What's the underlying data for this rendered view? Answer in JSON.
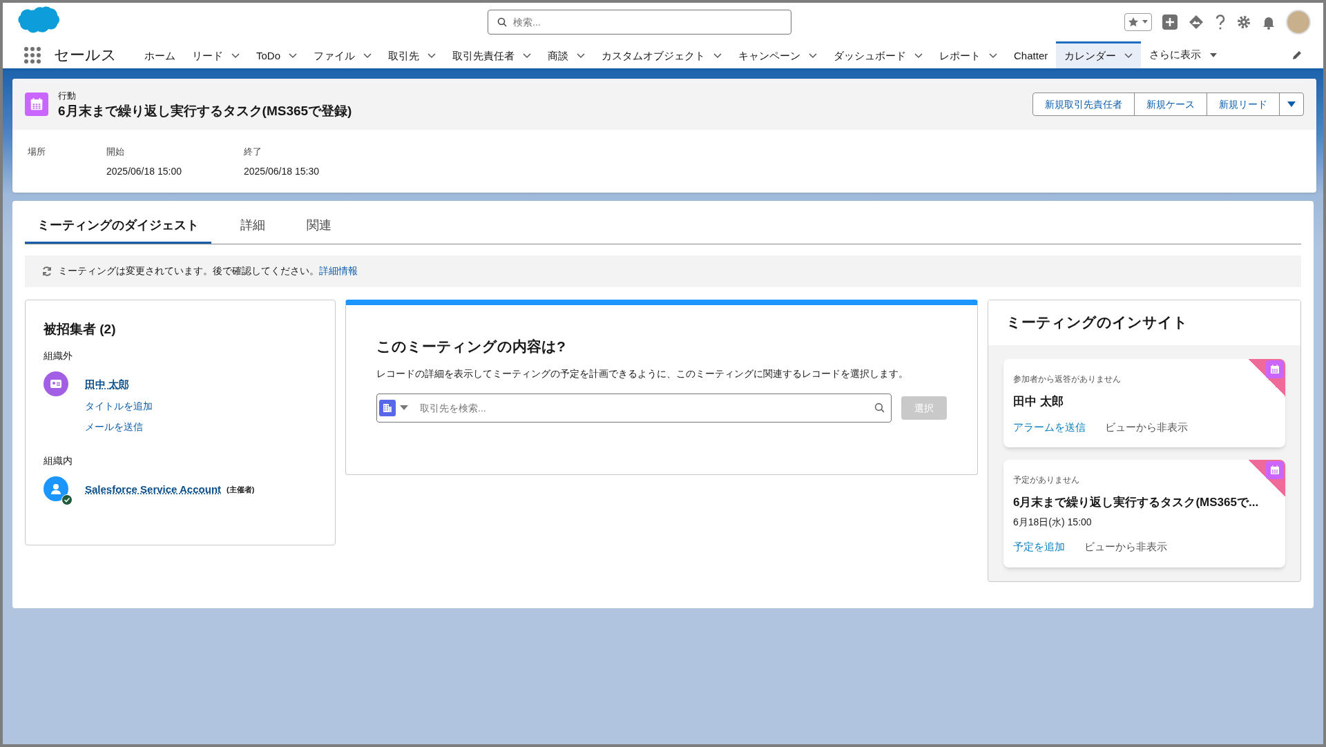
{
  "header": {
    "search": {
      "placeholder": "検索..."
    }
  },
  "nav": {
    "app_name": "セールス",
    "items": [
      {
        "label": "ホーム",
        "has_menu": false,
        "selected": false
      },
      {
        "label": "リード",
        "has_menu": true,
        "selected": false
      },
      {
        "label": "ToDo",
        "has_menu": true,
        "selected": false
      },
      {
        "label": "ファイル",
        "has_menu": true,
        "selected": false
      },
      {
        "label": "取引先",
        "has_menu": true,
        "selected": false
      },
      {
        "label": "取引先責任者",
        "has_menu": true,
        "selected": false
      },
      {
        "label": "商談",
        "has_menu": true,
        "selected": false
      },
      {
        "label": "カスタムオブジェクト",
        "has_menu": true,
        "selected": false
      },
      {
        "label": "キャンペーン",
        "has_menu": true,
        "selected": false
      },
      {
        "label": "ダッシュボード",
        "has_menu": true,
        "selected": false
      },
      {
        "label": "レポート",
        "has_menu": true,
        "selected": false
      },
      {
        "label": "Chatter",
        "has_menu": false,
        "selected": false
      },
      {
        "label": "カレンダー",
        "has_menu": true,
        "selected": true
      }
    ],
    "more": "さらに表示"
  },
  "record": {
    "object_type": "行動",
    "title": "6月末まで繰り返し実行するタスク(MS365で登録)",
    "actions": [
      "新規取引先責任者",
      "新規ケース",
      "新規リード"
    ],
    "fields": [
      {
        "label": "場所"
      },
      {
        "label": "開始",
        "value": "2025/06/18 15:00"
      },
      {
        "label": "終了",
        "value": "2025/06/18 15:30"
      }
    ]
  },
  "tabs": [
    {
      "label": "ミーティングのダイジェスト",
      "selected": true
    },
    {
      "label": "詳細",
      "selected": false
    },
    {
      "label": "関連",
      "selected": false
    }
  ],
  "banner": {
    "text": "ミーティングは変更されています。後で確認してください。",
    "link": "詳細情報"
  },
  "invitees": {
    "title": "被招集者 (2)",
    "groups": [
      {
        "label": "組織外",
        "people": [
          {
            "kind": "contact",
            "name": "田中 太郎",
            "links": [
              "タイトルを追加",
              "メールを送信"
            ]
          }
        ]
      },
      {
        "label": "組織内",
        "people": [
          {
            "kind": "user",
            "name": "Salesforce Service Account",
            "role": "(主催者)"
          }
        ]
      }
    ]
  },
  "related": {
    "title": "このミーティングの内容は?",
    "description": "レコードの詳細を表示してミーティングの予定を計画できるように、このミーティングに関連するレコードを選択します。",
    "search": {
      "placeholder": "取引先を検索..."
    },
    "select_button": {
      "label": "選択",
      "disabled": true
    }
  },
  "insights": {
    "title": "ミーティングのインサイト",
    "cards": [
      {
        "status": "参加者から返答がありません",
        "title": "田中 太郎",
        "action": "アラームを送信",
        "hide": "ビューから非表示"
      },
      {
        "status": "予定がありません",
        "title": "6月末まで繰り返し実行するタスク(MS365で...",
        "date": "6月18日(水) 15:00",
        "action": "予定を追加",
        "hide": "ビューから非表示"
      }
    ]
  }
}
